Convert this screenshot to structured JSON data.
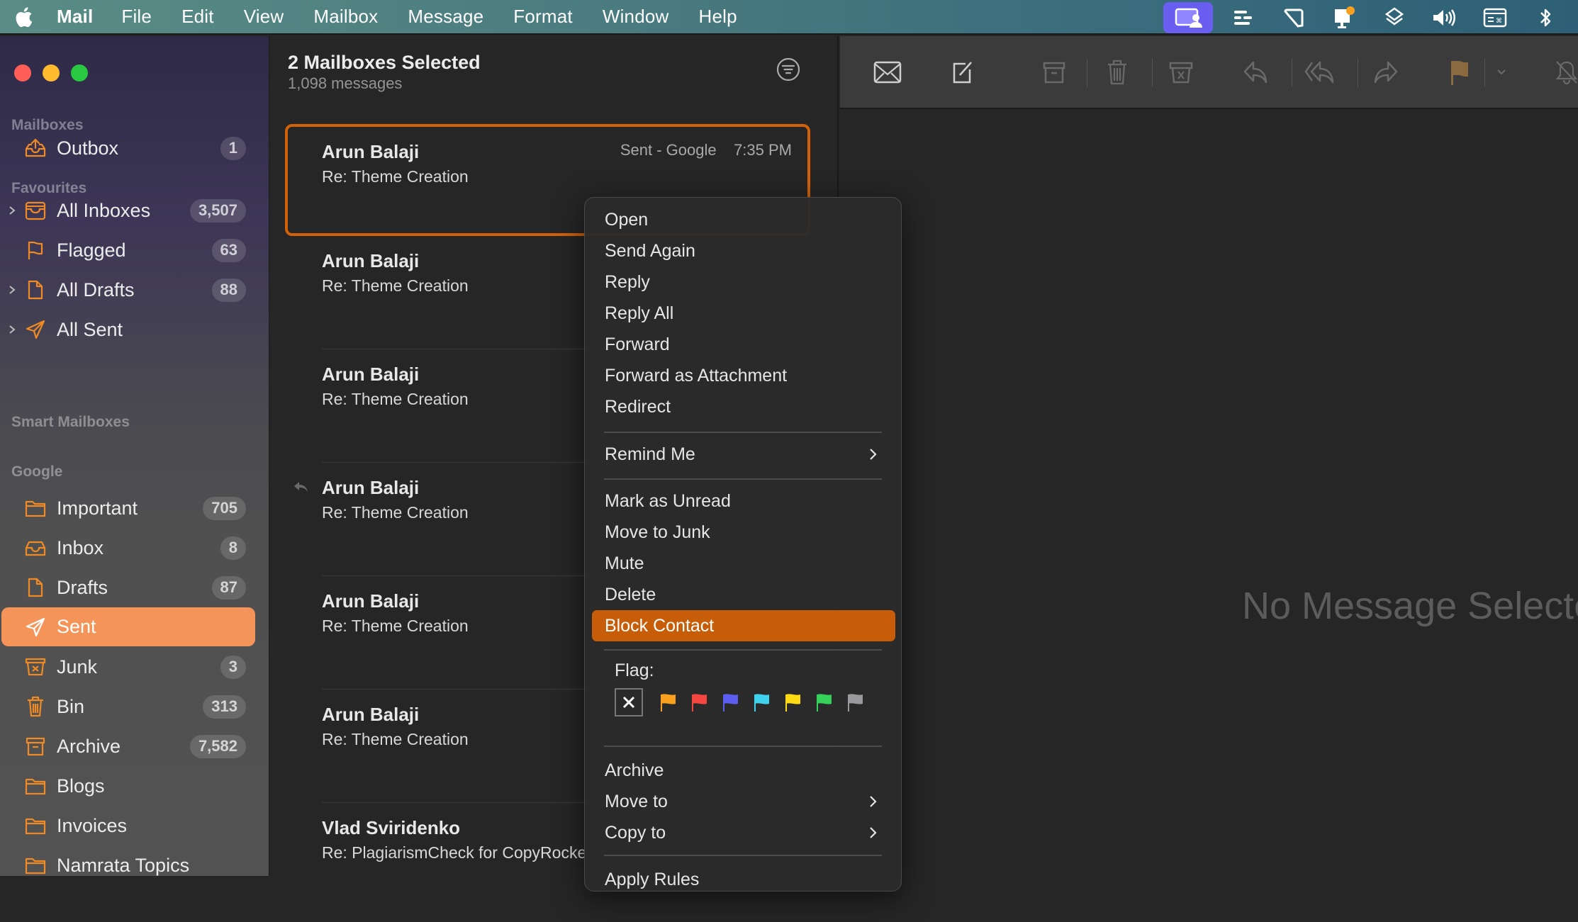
{
  "menubar": {
    "app": "Mail",
    "items": [
      "File",
      "Edit",
      "View",
      "Mailbox",
      "Message",
      "Format",
      "Window",
      "Help"
    ],
    "status_icons": [
      "screen-sharing-icon",
      "text-lines-icon",
      "sticky-icon",
      "notification-display-icon",
      "layers-icon",
      "volume-icon",
      "keyboard-viewer-icon",
      "bluetooth-icon"
    ]
  },
  "sidebar": {
    "sections": {
      "mailboxes": "Mailboxes",
      "favourites": "Favourites",
      "smart": "Smart Mailboxes",
      "google": "Google"
    },
    "mailboxes": [
      {
        "label": "Outbox",
        "badge": "1",
        "icon": "outbox-icon"
      }
    ],
    "favourites": [
      {
        "label": "All Inboxes",
        "badge": "3,507",
        "icon": "inbox-tray-icon",
        "expandable": true
      },
      {
        "label": "Flagged",
        "badge": "63",
        "icon": "flag-icon",
        "expandable": false
      },
      {
        "label": "All Drafts",
        "badge": "88",
        "icon": "draft-icon",
        "expandable": true
      },
      {
        "label": "All Sent",
        "badge": "",
        "icon": "sent-icon",
        "expandable": true
      }
    ],
    "google": [
      {
        "label": "Important",
        "badge": "705",
        "icon": "folder-icon"
      },
      {
        "label": "Inbox",
        "badge": "8",
        "icon": "inbox-tray-icon"
      },
      {
        "label": "Drafts",
        "badge": "87",
        "icon": "draft-icon"
      },
      {
        "label": "Sent",
        "badge": "",
        "icon": "sent-icon",
        "selected": true
      },
      {
        "label": "Junk",
        "badge": "3",
        "icon": "junk-icon"
      },
      {
        "label": "Bin",
        "badge": "313",
        "icon": "trash-icon"
      },
      {
        "label": "Archive",
        "badge": "7,582",
        "icon": "archive-icon"
      },
      {
        "label": "Blogs",
        "badge": "",
        "icon": "folder-icon"
      },
      {
        "label": "Invoices",
        "badge": "",
        "icon": "folder-icon"
      },
      {
        "label": "Namrata Topics",
        "badge": "",
        "icon": "folder-icon"
      }
    ]
  },
  "list": {
    "title": "2 Mailboxes Selected",
    "subtitle": "1,098 messages",
    "messages": [
      {
        "sender": "Arun Balaji",
        "subject": "Re: Theme Creation",
        "mailbox": "Sent - Google",
        "time": "7:35 PM",
        "selected": true
      },
      {
        "sender": "Arun Balaji",
        "subject": "Re: Theme Creation"
      },
      {
        "sender": "Arun Balaji",
        "subject": "Re: Theme Creation"
      },
      {
        "sender": "Arun Balaji",
        "subject": "Re: Theme Creation",
        "replied": true
      },
      {
        "sender": "Arun Balaji",
        "subject": "Re: Theme Creation"
      },
      {
        "sender": "Arun Balaji",
        "subject": "Re: Theme Creation"
      },
      {
        "sender": "Vlad Sviridenko",
        "subject": "Re: PlagiarismCheck for CopyRocket"
      }
    ]
  },
  "toolbar": {
    "buttons": [
      "get-mail",
      "compose",
      "archive",
      "delete",
      "junk",
      "reply",
      "reply-all",
      "forward",
      "flag",
      "flag-menu",
      "mute"
    ]
  },
  "reader": {
    "empty_text": "No Message Selected"
  },
  "context_menu": {
    "group1": [
      "Open",
      "Send Again",
      "Reply",
      "Reply All",
      "Forward",
      "Forward as Attachment",
      "Redirect"
    ],
    "remind": "Remind Me",
    "group2": [
      "Mark as Unread",
      "Move to Junk",
      "Mute",
      "Delete",
      "Block Contact"
    ],
    "highlighted": "Block Contact",
    "flag_label": "Flag:",
    "flag_colors": [
      "#f9a01e",
      "#f5473f",
      "#5c5ef2",
      "#3fd1ee",
      "#fedb14",
      "#35d158",
      "#9a9a9e"
    ],
    "group3": [
      "Archive",
      "Move to",
      "Copy to"
    ],
    "partial": "Apply Rules"
  },
  "colors": {
    "accent": "#c75d09",
    "sidebar_selected": "#f59458",
    "icon_orange": "#f08a24"
  }
}
